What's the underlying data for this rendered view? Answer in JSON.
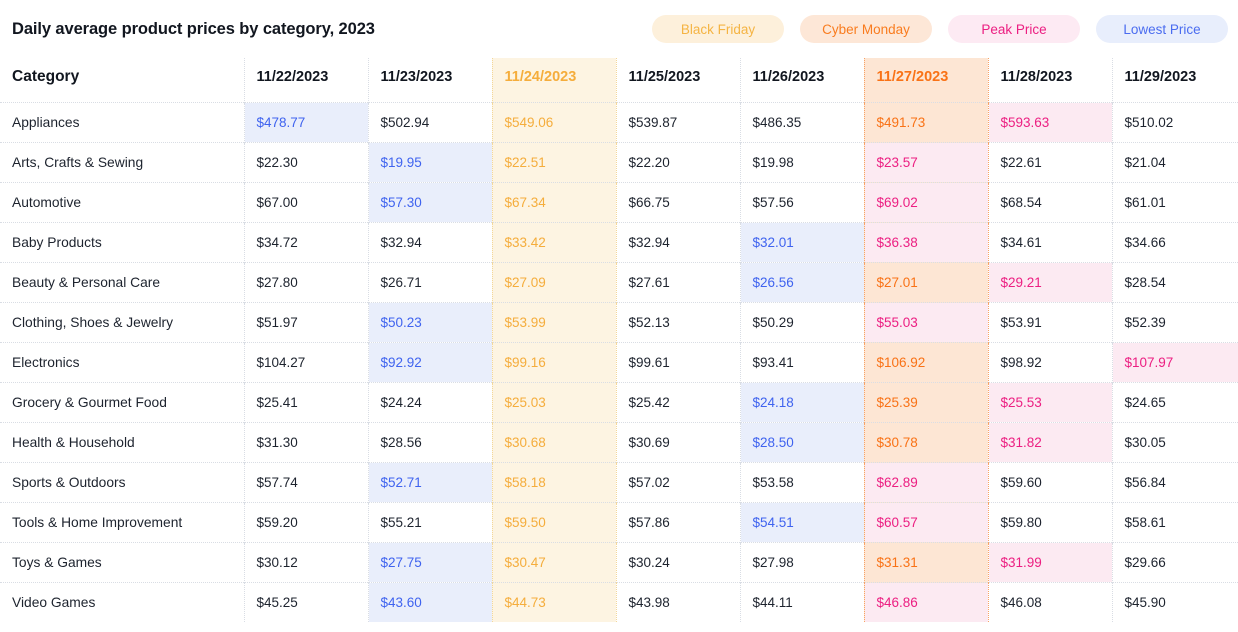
{
  "header": {
    "title": "Daily average product prices by category, 2023"
  },
  "legend": {
    "items": [
      {
        "label": "Black Friday",
        "key": "black_friday",
        "bg": "#fdf0db",
        "fg": "#f5b443"
      },
      {
        "label": "Cyber Monday",
        "key": "cyber_monday",
        "bg": "#fde7d7",
        "fg": "#f97c1f"
      },
      {
        "label": "Peak Price",
        "key": "peak",
        "bg": "#fdeaf3",
        "fg": "#ec1f82"
      },
      {
        "label": "Lowest Price",
        "key": "lowest",
        "bg": "#e8eefc",
        "fg": "#4a6cf0"
      }
    ]
  },
  "table": {
    "category_header": "Category",
    "columns": [
      {
        "label": "11/22/2023",
        "event": null
      },
      {
        "label": "11/23/2023",
        "event": null
      },
      {
        "label": "11/24/2023",
        "event": "black_friday"
      },
      {
        "label": "11/25/2023",
        "event": null
      },
      {
        "label": "11/26/2023",
        "event": null
      },
      {
        "label": "11/27/2023",
        "event": "cyber_monday"
      },
      {
        "label": "11/28/2023",
        "event": null
      },
      {
        "label": "11/29/2023",
        "event": null
      }
    ],
    "rows": [
      {
        "category": "Appliances",
        "values": [
          "$478.77",
          "$502.94",
          "$549.06",
          "$539.87",
          "$486.35",
          "$491.73",
          "$593.63",
          "$510.02"
        ],
        "marks": [
          "lowest",
          null,
          null,
          null,
          null,
          null,
          "peak",
          null
        ]
      },
      {
        "category": "Arts, Crafts & Sewing",
        "values": [
          "$22.30",
          "$19.95",
          "$22.51",
          "$22.20",
          "$19.98",
          "$23.57",
          "$22.61",
          "$21.04"
        ],
        "marks": [
          null,
          "lowest",
          null,
          null,
          null,
          "peak",
          null,
          null
        ]
      },
      {
        "category": "Automotive",
        "values": [
          "$67.00",
          "$57.30",
          "$67.34",
          "$66.75",
          "$57.56",
          "$69.02",
          "$68.54",
          "$61.01"
        ],
        "marks": [
          null,
          "lowest",
          null,
          null,
          null,
          "peak",
          null,
          null
        ]
      },
      {
        "category": "Baby Products",
        "values": [
          "$34.72",
          "$32.94",
          "$33.42",
          "$32.94",
          "$32.01",
          "$36.38",
          "$34.61",
          "$34.66"
        ],
        "marks": [
          null,
          null,
          null,
          null,
          "lowest",
          "peak",
          null,
          null
        ]
      },
      {
        "category": "Beauty & Personal Care",
        "values": [
          "$27.80",
          "$26.71",
          "$27.09",
          "$27.61",
          "$26.56",
          "$27.01",
          "$29.21",
          "$28.54"
        ],
        "marks": [
          null,
          null,
          null,
          null,
          "lowest",
          null,
          "peak",
          null
        ]
      },
      {
        "category": "Clothing, Shoes & Jewelry",
        "values": [
          "$51.97",
          "$50.23",
          "$53.99",
          "$52.13",
          "$50.29",
          "$55.03",
          "$53.91",
          "$52.39"
        ],
        "marks": [
          null,
          "lowest",
          null,
          null,
          null,
          "peak",
          null,
          null
        ]
      },
      {
        "category": "Electronics",
        "values": [
          "$104.27",
          "$92.92",
          "$99.16",
          "$99.61",
          "$93.41",
          "$106.92",
          "$98.92",
          "$107.97"
        ],
        "marks": [
          null,
          "lowest",
          null,
          null,
          null,
          null,
          null,
          "peak"
        ]
      },
      {
        "category": "Grocery & Gourmet Food",
        "values": [
          "$25.41",
          "$24.24",
          "$25.03",
          "$25.42",
          "$24.18",
          "$25.39",
          "$25.53",
          "$24.65"
        ],
        "marks": [
          null,
          null,
          null,
          null,
          "lowest",
          null,
          "peak",
          null
        ]
      },
      {
        "category": "Health & Household",
        "values": [
          "$31.30",
          "$28.56",
          "$30.68",
          "$30.69",
          "$28.50",
          "$30.78",
          "$31.82",
          "$30.05"
        ],
        "marks": [
          null,
          null,
          null,
          null,
          "lowest",
          null,
          "peak",
          null
        ]
      },
      {
        "category": "Sports & Outdoors",
        "values": [
          "$57.74",
          "$52.71",
          "$58.18",
          "$57.02",
          "$53.58",
          "$62.89",
          "$59.60",
          "$56.84"
        ],
        "marks": [
          null,
          "lowest",
          null,
          null,
          null,
          "peak",
          null,
          null
        ]
      },
      {
        "category": "Tools & Home Improvement",
        "values": [
          "$59.20",
          "$55.21",
          "$59.50",
          "$57.86",
          "$54.51",
          "$60.57",
          "$59.80",
          "$58.61"
        ],
        "marks": [
          null,
          null,
          null,
          null,
          "lowest",
          "peak",
          null,
          null
        ]
      },
      {
        "category": "Toys & Games",
        "values": [
          "$30.12",
          "$27.75",
          "$30.47",
          "$30.24",
          "$27.98",
          "$31.31",
          "$31.99",
          "$29.66"
        ],
        "marks": [
          null,
          "lowest",
          null,
          null,
          null,
          null,
          "peak",
          null
        ]
      },
      {
        "category": "Video Games",
        "values": [
          "$45.25",
          "$43.60",
          "$44.73",
          "$43.98",
          "$44.11",
          "$46.86",
          "$46.08",
          "$45.90"
        ],
        "marks": [
          null,
          "lowest",
          null,
          null,
          null,
          "peak",
          null,
          null
        ]
      }
    ]
  },
  "chart_data": {
    "type": "table",
    "title": "Daily average product prices by category, 2023",
    "xlabel": "",
    "ylabel": "",
    "categories": [
      "Appliances",
      "Arts, Crafts & Sewing",
      "Automotive",
      "Baby Products",
      "Beauty & Personal Care",
      "Clothing, Shoes & Jewelry",
      "Electronics",
      "Grocery & Gourmet Food",
      "Health & Household",
      "Sports & Outdoors",
      "Tools & Home Improvement",
      "Toys & Games",
      "Video Games"
    ],
    "x": [
      "11/22/2023",
      "11/23/2023",
      "11/24/2023",
      "11/25/2023",
      "11/26/2023",
      "11/27/2023",
      "11/28/2023",
      "11/29/2023"
    ],
    "series": [
      {
        "name": "Appliances",
        "values": [
          478.77,
          502.94,
          549.06,
          539.87,
          486.35,
          491.73,
          593.63,
          510.02
        ]
      },
      {
        "name": "Arts, Crafts & Sewing",
        "values": [
          22.3,
          19.95,
          22.51,
          22.2,
          19.98,
          23.57,
          22.61,
          21.04
        ]
      },
      {
        "name": "Automotive",
        "values": [
          67.0,
          57.3,
          67.34,
          66.75,
          57.56,
          69.02,
          68.54,
          61.01
        ]
      },
      {
        "name": "Baby Products",
        "values": [
          34.72,
          32.94,
          33.42,
          32.94,
          32.01,
          36.38,
          34.61,
          34.66
        ]
      },
      {
        "name": "Beauty & Personal Care",
        "values": [
          27.8,
          26.71,
          27.09,
          27.61,
          26.56,
          27.01,
          29.21,
          28.54
        ]
      },
      {
        "name": "Clothing, Shoes & Jewelry",
        "values": [
          51.97,
          50.23,
          53.99,
          52.13,
          50.29,
          55.03,
          53.91,
          52.39
        ]
      },
      {
        "name": "Electronics",
        "values": [
          104.27,
          92.92,
          99.16,
          99.61,
          93.41,
          106.92,
          98.92,
          107.97
        ]
      },
      {
        "name": "Grocery & Gourmet Food",
        "values": [
          25.41,
          24.24,
          25.03,
          25.42,
          24.18,
          25.39,
          25.53,
          24.65
        ]
      },
      {
        "name": "Health & Household",
        "values": [
          31.3,
          28.56,
          30.68,
          30.69,
          28.5,
          30.78,
          31.82,
          30.05
        ]
      },
      {
        "name": "Sports & Outdoors",
        "values": [
          57.74,
          52.71,
          58.18,
          57.02,
          53.58,
          62.89,
          59.6,
          56.84
        ]
      },
      {
        "name": "Tools & Home Improvement",
        "values": [
          59.2,
          55.21,
          59.5,
          57.86,
          54.51,
          60.57,
          59.8,
          58.61
        ]
      },
      {
        "name": "Toys & Games",
        "values": [
          30.12,
          27.75,
          30.47,
          30.24,
          27.98,
          31.31,
          31.99,
          29.66
        ]
      },
      {
        "name": "Video Games",
        "values": [
          45.25,
          43.6,
          44.73,
          43.98,
          44.11,
          46.86,
          46.08,
          45.9
        ]
      }
    ],
    "legend": [
      "Black Friday",
      "Cyber Monday",
      "Peak Price",
      "Lowest Price"
    ],
    "legend_position": "top-right",
    "grid": true,
    "annotations": {
      "black_friday_column": "11/24/2023",
      "cyber_monday_column": "11/27/2023"
    }
  }
}
